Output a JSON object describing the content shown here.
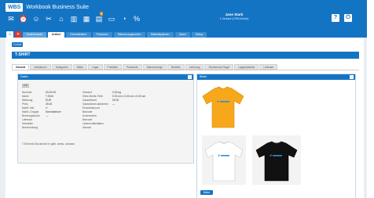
{
  "app": {
    "logo_badge": "WBS",
    "suite_name": "Workbook Business Suite"
  },
  "toolbar": {
    "icons": [
      {
        "name": "mail-icon",
        "glyph": "✉",
        "badge": ""
      },
      {
        "name": "alarm-icon",
        "glyph": "⏰",
        "badge": ""
      },
      {
        "name": "people-icon",
        "glyph": "☺",
        "badge": ""
      },
      {
        "name": "tools-icon",
        "glyph": "✂",
        "badge": ""
      },
      {
        "name": "warehouse-icon",
        "glyph": "⌂",
        "badge": ""
      },
      {
        "name": "chart-icon",
        "glyph": "▥",
        "badge": ""
      },
      {
        "name": "calendar-icon",
        "glyph": "▦",
        "badge": ""
      },
      {
        "name": "notes-icon",
        "glyph": "▤",
        "badge": "1"
      },
      {
        "name": "folder-icon",
        "glyph": "▭",
        "badge": ""
      },
      {
        "name": "report-icon",
        "glyph": "◔",
        "badge": ""
      },
      {
        "name": "percent-icon",
        "glyph": "%",
        "badge": ""
      }
    ]
  },
  "user": {
    "name": "Jane Stark",
    "subtitle": "1 Verkauf (CRM-Modul)"
  },
  "header_buttons": {
    "help": "?",
    "exit": "⏻"
  },
  "module_tabs": {
    "home_glyph": "⌂",
    "close_glyph": "✕",
    "tabs": [
      {
        "label": "Dashboards",
        "state": "open"
      },
      {
        "label": "Artikel",
        "state": "active"
      },
      {
        "label": "Dienstleisten",
        "state": ""
      },
      {
        "label": "Finanzen",
        "state": ""
      },
      {
        "label": "Stämmungssorten",
        "state": ""
      },
      {
        "label": "Statistikplanen",
        "state": ""
      },
      {
        "label": "Jahre",
        "state": ""
      },
      {
        "label": "Setup",
        "state": ""
      }
    ]
  },
  "page": {
    "back_label": "Zurück",
    "title": "T-SHIRT"
  },
  "sub_tabs": [
    {
      "label": "General",
      "active": true
    },
    {
      "label": "Variationen",
      "active": false
    },
    {
      "label": "Kategorien",
      "active": false
    },
    {
      "label": "Bilder",
      "active": false
    },
    {
      "label": "Lager",
      "active": false
    },
    {
      "label": "Preisliste",
      "active": false
    },
    {
      "label": "Preisstufe",
      "active": false
    },
    {
      "label": "Warenbezüge",
      "active": false
    },
    {
      "label": "Bestelle",
      "active": false
    },
    {
      "label": "Lieferung",
      "active": false
    },
    {
      "label": "Sichtschutz-Regel",
      "active": false
    },
    {
      "label": "Lagerplatzliste",
      "active": false
    },
    {
      "label": "Lieferant",
      "active": false
    }
  ],
  "details_panel": {
    "title": "Daten",
    "toggle": "−",
    "edit_label": "Edit",
    "left_fields": [
      {
        "key": "Nummer",
        "value": "00-00-00"
      },
      {
        "key": "Name",
        "value": "T-Shirt"
      },
      {
        "key": "Währung",
        "value": "EUR"
      },
      {
        "key": "Preis",
        "value": "25.00"
      },
      {
        "key": "MwSt. inkl.",
        "value": "✔"
      },
      {
        "key": "MwSt.-Gruppe",
        "value": "Normalsteuer"
      },
      {
        "key": "Buchungskonto",
        "value": "—"
      },
      {
        "key": "Lieferant",
        "value": ""
      },
      {
        "key": "Hersteller",
        "value": ""
      },
      {
        "key": "Beschreibung",
        "value": ""
      }
    ],
    "right_fields": [
      {
        "key": "Gewicht",
        "value": "0.00 kg"
      },
      {
        "key": "Höhe-Breite-Tiefe",
        "value": "0.00 cm x 0.00 cm x 0.00 cm"
      },
      {
        "key": "Garantiezeit",
        "value": "00.00"
      },
      {
        "key": "Garantiezeit aktivieren",
        "value": "—"
      },
      {
        "key": "Einzelarticount",
        "value": ""
      },
      {
        "key": "Barcode",
        "value": ""
      },
      {
        "key": "Accessories",
        "value": ""
      },
      {
        "key": "Barcode",
        "value": ""
      },
      {
        "key": "Lebensmitteldaten",
        "value": ""
      },
      {
        "key": "Artwork",
        "value": ""
      }
    ],
    "description": "T-Shirt mit Druckmotiv in gelb, weiss, schwarz"
  },
  "images_panel": {
    "title": "Bilder",
    "toggle": "−",
    "button_label": "Bilder",
    "images": [
      {
        "name": "yellow-tshirt-image",
        "color": "#f6a81a"
      },
      {
        "name": "white-tshirt-image",
        "color": "#ffffff"
      },
      {
        "name": "black-tshirt-image",
        "color": "#111111"
      }
    ]
  },
  "colors": {
    "primary": "#1474c4",
    "close_tab": "#e2352b",
    "badge": "#f7941d",
    "logo_print": "#2a8fd6"
  }
}
